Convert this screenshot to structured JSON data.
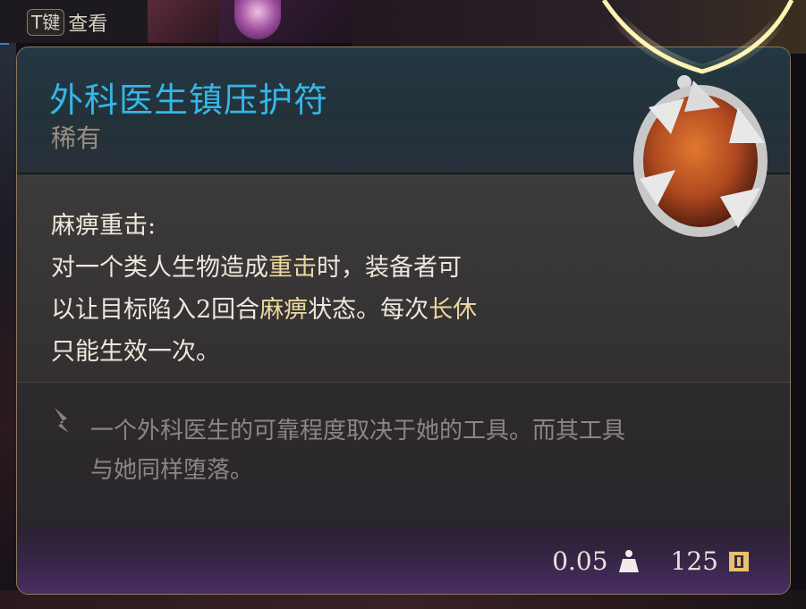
{
  "hotkey": {
    "key": "T键",
    "label": "查看"
  },
  "item": {
    "name": "外科医生镇压护符",
    "rarity": "稀有",
    "effect": {
      "name": "麻痹重击:",
      "line1_a": "对一个类人生物造成",
      "line1_hl": "重击",
      "line1_b": "时，装备者可",
      "line2_a": "以让目标陷入2回合",
      "line2_hl1": "麻痹",
      "line2_b": "状态。每次",
      "line2_hl2": "长休",
      "line3": "只能生效一次。"
    },
    "lore_line1": "一个外科医生的可靠程度取决于她的工具。而其工具",
    "lore_line2": "与她同样堕落。",
    "weight": "0.05",
    "value": "125"
  },
  "colors": {
    "title": "#35b6e8",
    "highlight": "#ecd6a0",
    "rarity": "#9a8e82",
    "lore": "#8e8580"
  },
  "icons": [
    "weight-icon",
    "gold-icon",
    "lore-quill-icon",
    "amulet-image"
  ]
}
